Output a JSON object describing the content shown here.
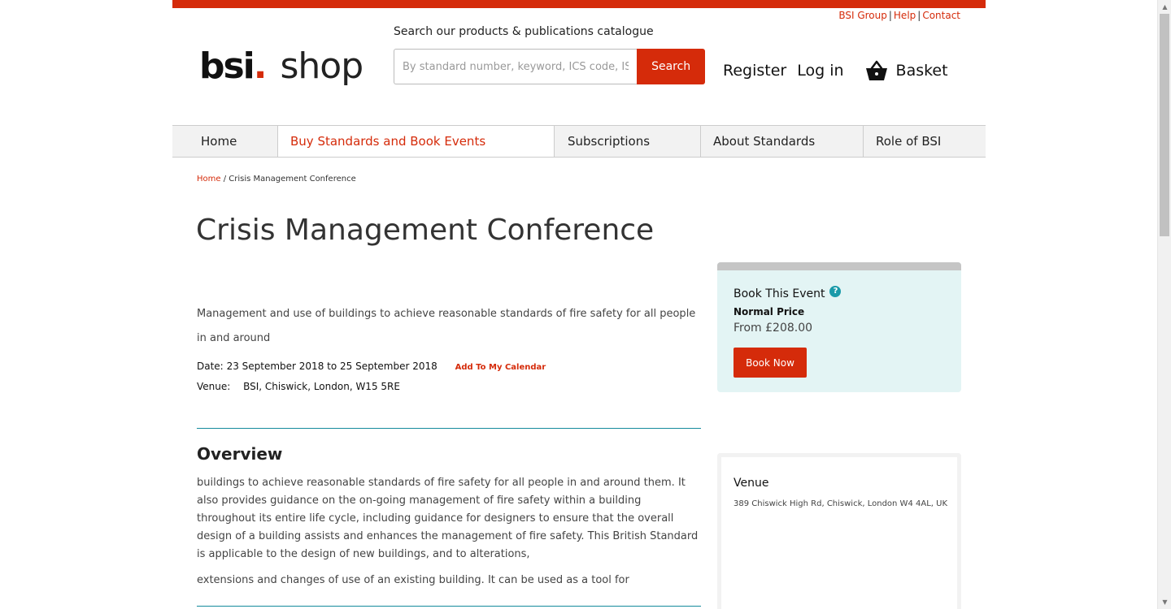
{
  "utility_links": [
    {
      "label": "BSI Group"
    },
    {
      "label": "Help"
    },
    {
      "label": "Contact"
    }
  ],
  "logo": {
    "bsi": "bsi",
    "dot": ".",
    "shop": "shop"
  },
  "search": {
    "heading": "Search our products & publications catalogue",
    "placeholder": "By standard number, keyword, ICS code, ISBN",
    "button": "Search"
  },
  "header_actions": {
    "register": "Register",
    "login": "Log in",
    "basket": "Basket",
    "basket_icon": "basket-icon"
  },
  "nav": [
    {
      "label": "Home",
      "active": false
    },
    {
      "label": "Buy Standards and Book Events",
      "active": true
    },
    {
      "label": "Subscriptions",
      "active": false
    },
    {
      "label": "About Standards",
      "active": false
    },
    {
      "label": "Role of BSI",
      "active": false
    }
  ],
  "breadcrumb": {
    "home": "Home",
    "separator": "/",
    "current": "Crisis Management Conference"
  },
  "event": {
    "title": "Crisis Management Conference",
    "intro": "Management and use of buildings to achieve reasonable standards of fire safety for all people in and around",
    "date_label": "Date:",
    "date_value": "23 September 2018 to 25 September 2018",
    "calendar_link": "Add To My Calendar",
    "venue_label": "Venue:",
    "venue_value": "BSI, Chiswick, London, W15 5RE"
  },
  "overview": {
    "title": "Overview",
    "p1": "buildings to achieve reasonable standards of fire safety for all people in and around them. It also provides guidance on the on-going management of fire safety within a building throughout its entire life cycle, including guidance for designers to ensure that the overall design of a building assists and enhances the management of fire safety. This British Standard is applicable to the design of new buildings, and to alterations,",
    "p2": "extensions and changes of use of an existing building. It can be used as a tool for"
  },
  "booking": {
    "title": "Book This Event",
    "help_icon": "help-icon",
    "help_glyph": "?",
    "price_label": "Normal Price",
    "price_value": "From £208.00",
    "button": "Book Now"
  },
  "venue_box": {
    "title": "Venue",
    "address": "389 Chiswick High Rd, Chiswick, London W4 4AL, UK"
  },
  "colors": {
    "brand_red": "#d52b0a",
    "teal_rule": "#148a9c",
    "booking_bg": "#e3f4f4"
  }
}
